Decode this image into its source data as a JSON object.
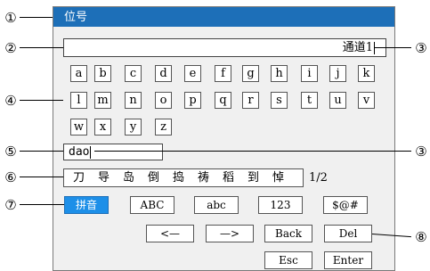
{
  "dialog": {
    "title": "位号"
  },
  "tag_field": {
    "value": "通道1"
  },
  "letter_keys": [
    "a",
    "b",
    "c",
    "d",
    "e",
    "f",
    "g",
    "h",
    "i",
    "j",
    "k",
    "l",
    "m",
    "n",
    "o",
    "p",
    "q",
    "r",
    "s",
    "t",
    "u",
    "v",
    "w",
    "x",
    "y",
    "z"
  ],
  "pinyin_input": {
    "value": "dao"
  },
  "candidates": [
    "刀",
    "导",
    "岛",
    "倒",
    "捣",
    "祷",
    "稻",
    "到",
    "悼"
  ],
  "candidate_page": "1/2",
  "mode_buttons": {
    "pinyin": "拼音",
    "upper": "ABC",
    "lower": "abc",
    "digits": "123",
    "symbols": "$@#"
  },
  "nav_buttons": {
    "left": "<—",
    "right": "—>",
    "back": "Back",
    "del": "Del"
  },
  "action_buttons": {
    "esc": "Esc",
    "enter": "Enter"
  },
  "callouts": [
    "①",
    "②",
    "③",
    "④",
    "⑤",
    "③",
    "⑥",
    "⑦",
    "⑧"
  ],
  "colors": {
    "titlebar": "#1d6fb8",
    "active_button": "#1d8fe8"
  }
}
